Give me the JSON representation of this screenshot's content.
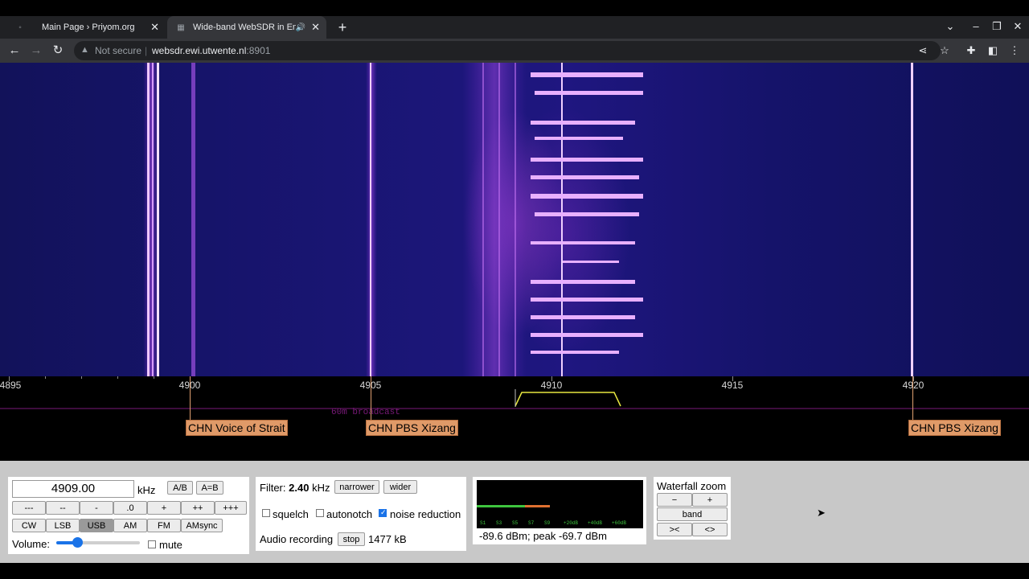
{
  "browser": {
    "tabs": [
      {
        "title": "Main Page › Priyom.org",
        "favicon": "priyom-icon"
      },
      {
        "title": "Wide-band WebSDR in Ensch",
        "favicon": "websdr-icon",
        "audio": true
      }
    ],
    "new_tab": "+",
    "address": {
      "security": "Not secure",
      "host": "websdr.ewi.utwente.nl",
      "port": ":8901"
    }
  },
  "scale": {
    "ticks": [
      {
        "label": "4895"
      },
      {
        "label": "4900"
      },
      {
        "label": "4905"
      },
      {
        "label": "4910"
      },
      {
        "label": "4915"
      },
      {
        "label": "4920"
      }
    ],
    "band_label": "60m broadcast",
    "stations": [
      {
        "label": "CHN Voice of Strait"
      },
      {
        "label": "CHN PBS Xizang"
      },
      {
        "label": "CHN PBS Xizang"
      }
    ]
  },
  "tuning": {
    "frequency": "4909.00",
    "unit": "kHz",
    "ab_label": "A/B",
    "aeqb_label": "A=B",
    "step_buttons": [
      "---",
      "--",
      "-",
      ".0",
      "+",
      "++",
      "+++"
    ],
    "modes": [
      "CW",
      "LSB",
      "USB",
      "AM",
      "FM",
      "AMsync"
    ],
    "selected_mode": "USB",
    "volume_label": "Volume:",
    "volume_level": 0.25,
    "mute_label": "mute"
  },
  "filter": {
    "label": "Filter:",
    "bandwidth": "2.40",
    "unit": "kHz",
    "narrower": "narrower",
    "wider": "wider",
    "squelch": "squelch",
    "autonotch": "autonotch",
    "noise_reduction": "noise reduction",
    "noise_reduction_checked": true,
    "recording_label": "Audio recording",
    "stop": "stop",
    "recording_size": "1477 kB"
  },
  "smeter": {
    "scale": [
      "S1",
      "S3",
      "S5",
      "S7",
      "S9",
      "+20dB",
      "+40dB",
      "+60dB"
    ],
    "reading": "-89.6 dBm; peak  -69.7 dBm",
    "colors": {
      "green": "#3ec43e",
      "orange": "#e07030"
    }
  },
  "zoom": {
    "title": "Waterfall zoom",
    "minus": "−",
    "plus": "+",
    "band": "band",
    "narrow": "><",
    "widen": "<>"
  }
}
